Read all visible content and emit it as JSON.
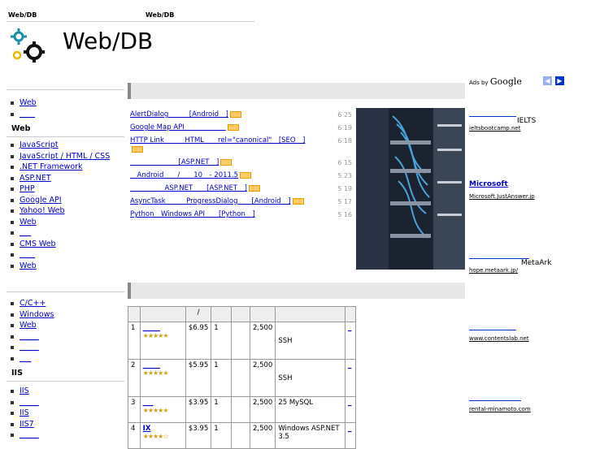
{
  "header": {
    "left_label": "Web/DB",
    "mid_label": "Web/DB",
    "logo_text": "Web/DB"
  },
  "sidebar": {
    "top_items": [
      "Web",
      "____"
    ],
    "section1_title": "Web",
    "section1_items": [
      "JavaScript",
      "JavaScript / HTML / CSS",
      ".NET Framework",
      "ASP.NET",
      "PHP",
      "Google API",
      "Yahoo! Web",
      "Web",
      "___",
      "CMS Web",
      "____",
      "Web"
    ],
    "section2_items": [
      "C/C++",
      "Windows",
      "Web",
      "_____",
      "_____",
      "___"
    ],
    "section2_title": "IIS",
    "section3_items": [
      "IIS",
      "_____",
      "IIS",
      "IIS7",
      "_____"
    ]
  },
  "articles": [
    {
      "text": "AlertDialog　　　[Android　]",
      "date": "6 25",
      "badge": true
    },
    {
      "text": "Google Map API　　　　　　",
      "date": "6 19",
      "badge": true
    },
    {
      "text": "HTTP Link　　　HTML　　rel=\"canonical\"　[SEO　]",
      "date": "6 18",
      "badge": true
    },
    {
      "text": "　　　　　　　[ASP.NET　]",
      "date": "6 15",
      "badge": true
    },
    {
      "text": "　Android　　/　　10　- 2011.5",
      "date": "5 23",
      "badge": true
    },
    {
      "text": "　　　　　ASP.NET　　[ASP.NET　]",
      "date": "5 19",
      "badge": true
    },
    {
      "text": "AsyncTask　　　ProgressDialog　　[Android　]",
      "date": "5 17",
      "badge": true
    },
    {
      "text": "Python　Windows API　　[Python　]",
      "date": "5 16",
      "badge": false
    }
  ],
  "table": {
    "headers": [
      "",
      "",
      "/",
      "",
      "",
      "",
      "",
      ""
    ],
    "rows": [
      {
        "rank": "1",
        "name": "_____",
        "price": "$6.95",
        "c1": "1",
        "c2": "",
        "disk": "2,500",
        "note": "SSH",
        "link": "_"
      },
      {
        "rank": "2",
        "name": "_____",
        "price": "$5.95",
        "c1": "1",
        "c2": "",
        "disk": "2,500",
        "note": "SSH",
        "link": "_"
      },
      {
        "rank": "3",
        "name": "___",
        "price": "$3.95",
        "c1": "1",
        "c2": "",
        "disk": "2,500",
        "note": "25 MySQL",
        "link": "_"
      },
      {
        "rank": "4",
        "name": "IX",
        "price": "$3.95",
        "c1": "1",
        "c2": "",
        "disk": "2,500",
        "note": "Windows ASP.NET 3.5",
        "link": "_"
      }
    ],
    "stars": [
      "★★★★★",
      "★★★★★",
      "★★★★★",
      "★★★★☆"
    ]
  },
  "ads": {
    "label": "Ads by",
    "brand": "Google",
    "items": [
      {
        "title": "IELTS",
        "url": "ieltsbootcamp.net"
      },
      {
        "title": "Microsoft",
        "url": "Microsoft.JustAnswer.jp"
      },
      {
        "title": "MetaArk",
        "url": "hope.metaark.jp/"
      },
      {
        "title": "",
        "url": "www.contentslab.net"
      },
      {
        "title": "",
        "url": "rental-minamoto.com"
      }
    ]
  }
}
